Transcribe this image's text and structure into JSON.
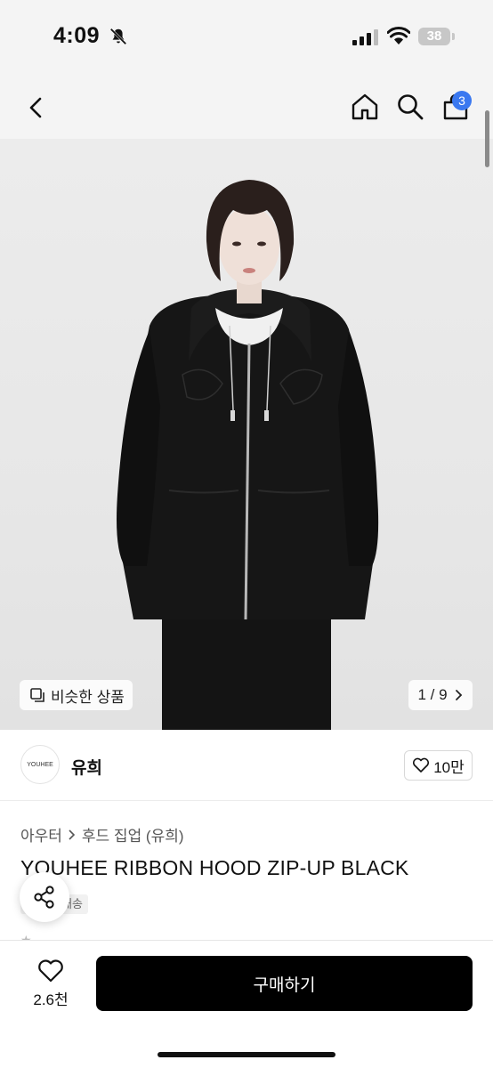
{
  "status_bar": {
    "time": "4:09",
    "battery": "38"
  },
  "header": {
    "cart_count": "3"
  },
  "image_overlay": {
    "similar_label": "비슷한 상품",
    "page_counter": "1 / 9"
  },
  "shop": {
    "logo_text": "YOUHEE",
    "name": "유희",
    "likes": "10만"
  },
  "product": {
    "breadcrumb": [
      "아우터",
      "후드 집업 (유희)"
    ],
    "title": "YOUHEE RIBBON HOOD ZIP-UP BLACK",
    "delivery_badge": "배송"
  },
  "bottom_bar": {
    "wish_count": "2.6천",
    "buy_label": "구매하기"
  },
  "colors": {
    "accent": "#3a78f0",
    "buy_button": "#000000"
  }
}
